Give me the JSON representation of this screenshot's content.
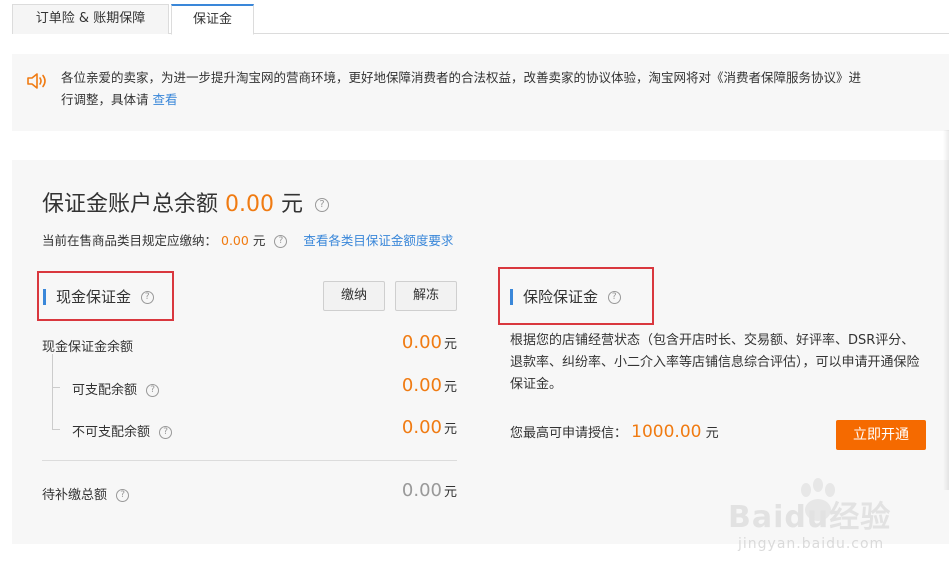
{
  "tabs": [
    {
      "label": "订单险 & 账期保障",
      "active": false
    },
    {
      "label": "保证金",
      "active": true
    }
  ],
  "notice": {
    "icon": "speaker-icon",
    "text": "各位亲爱的卖家，为进一步提升淘宝网的营商环境，更好地保障消费者的合法权益，改善卖家的协议体验，淘宝网将对《消费者保障服务协议》进行调整，具体请",
    "link": "查看"
  },
  "account": {
    "title": "保证金账户总余额",
    "amount": "0.00",
    "unit": "元",
    "required_label": "当前在售商品类目规定应缴纳：",
    "required_amount": "0.00",
    "required_unit": "元",
    "requirements_link": "查看各类目保证金额度要求"
  },
  "cash": {
    "title": "现金保证金",
    "pay_button": "缴纳",
    "thaw_button": "解冻",
    "balance_label": "现金保证金余额",
    "balance": "0.00",
    "available_label": "可支配余额",
    "available": "0.00",
    "unavailable_label": "不可支配余额",
    "unavailable": "0.00",
    "pending_label": "待补缴总额",
    "pending": "0.00",
    "unit": "元"
  },
  "insurance": {
    "title": "保险保证金",
    "description": "根据您的店铺经营状态（包含开店时长、交易额、好评率、DSR评分、退款率、纠纷率、小二介入率等店铺信息综合评估），可以申请开通保险保证金。",
    "credit_label": "您最高可申请授信：",
    "credit": "1000.00",
    "unit": "元",
    "open_button": "立即开通"
  },
  "help_icon_text": "?",
  "watermark": {
    "logo": "Baidu经验",
    "url": "jingyan.baidu.com"
  },
  "colors": {
    "accent": "#f07b12",
    "link": "#3a87d9",
    "primary_button": "#f56a00",
    "highlight_box": "#d9373e"
  }
}
